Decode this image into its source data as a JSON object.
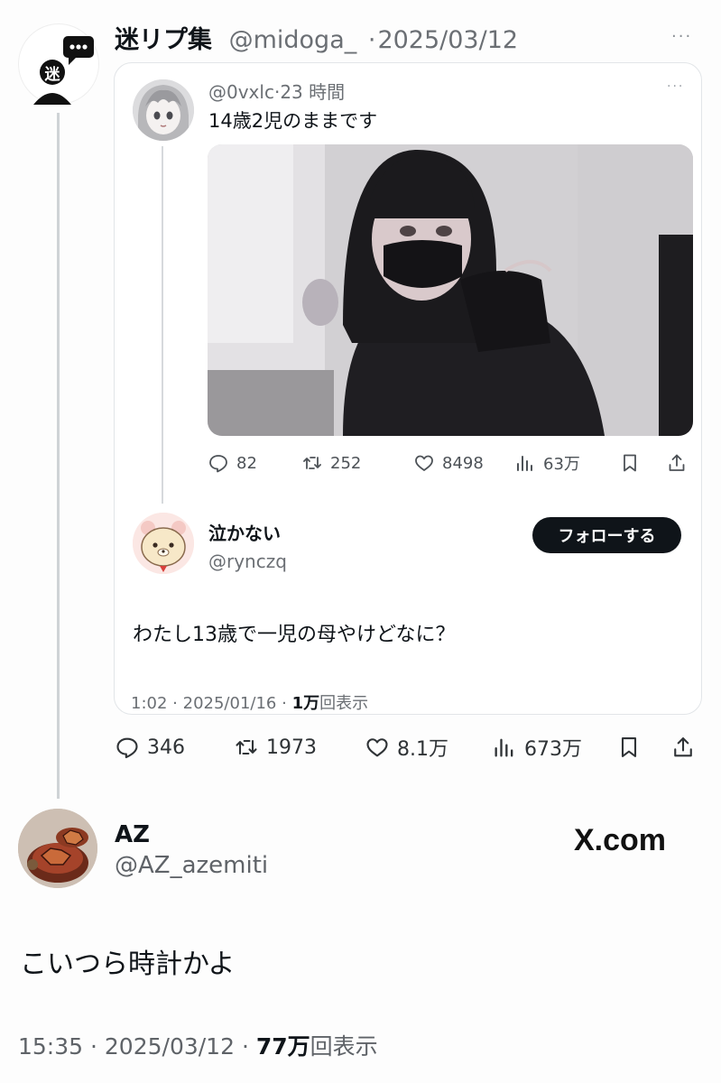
{
  "outer_tweet": {
    "avatar_char": "迷",
    "name": "迷リプ集",
    "handle": "@midoga_",
    "date_sep": "·",
    "date": "2025/03/12",
    "more": "···",
    "stats": {
      "replies": "346",
      "reposts": "1973",
      "likes": "8.1万",
      "views": "673万"
    }
  },
  "quoted_post": {
    "handle": "@0vxlc",
    "sep": "·",
    "time": "23 時間",
    "more": "···",
    "text": "14歳2児のままです",
    "stats": {
      "replies": "82",
      "reposts": "252",
      "likes": "8498",
      "views": "63万"
    }
  },
  "reply_post": {
    "name": "泣かない",
    "handle": "@rynczq",
    "follow_label": "フォローする",
    "text": "わたし13歳で一児の母やけどなに？",
    "time": "1:02",
    "sep": "·",
    "date": "2025/01/16",
    "sep2": "·",
    "views_count": "1万",
    "views_label": "回表示"
  },
  "main_tweet": {
    "name": "AZ",
    "handle": "@AZ_azemiti",
    "site": "X.com",
    "text": "こいつら時計かよ",
    "time": "15:35",
    "sep": "·",
    "date": "2025/03/12",
    "sep2": "·",
    "views_count": "77万",
    "views_label": "回表示"
  },
  "icons": [
    "reply-icon",
    "repost-icon",
    "like-icon",
    "views-icon",
    "bookmark-icon",
    "share-icon"
  ]
}
